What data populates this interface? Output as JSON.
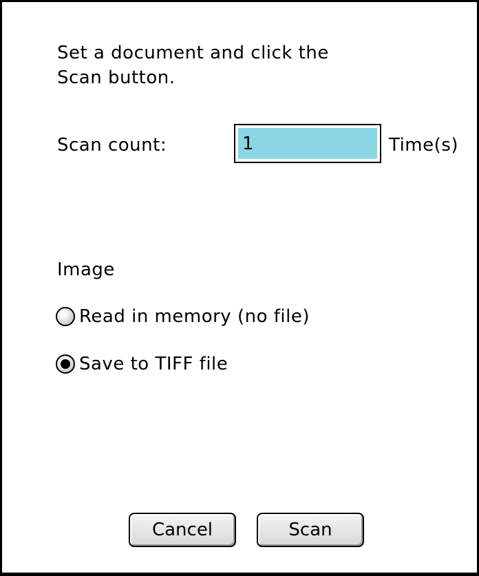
{
  "instruction": {
    "line1": "Set a document and click the",
    "line2": "Scan button."
  },
  "scan_count": {
    "label": "Scan count:",
    "value": "1",
    "unit": "Time(s)"
  },
  "image": {
    "label": "Image",
    "options": [
      {
        "label": "Read in memory (no file)",
        "selected": false
      },
      {
        "label": "Save to TIFF file",
        "selected": true
      }
    ]
  },
  "buttons": {
    "cancel": "Cancel",
    "scan": "Scan"
  },
  "colors": {
    "field_highlight": "#8ad6e2"
  }
}
